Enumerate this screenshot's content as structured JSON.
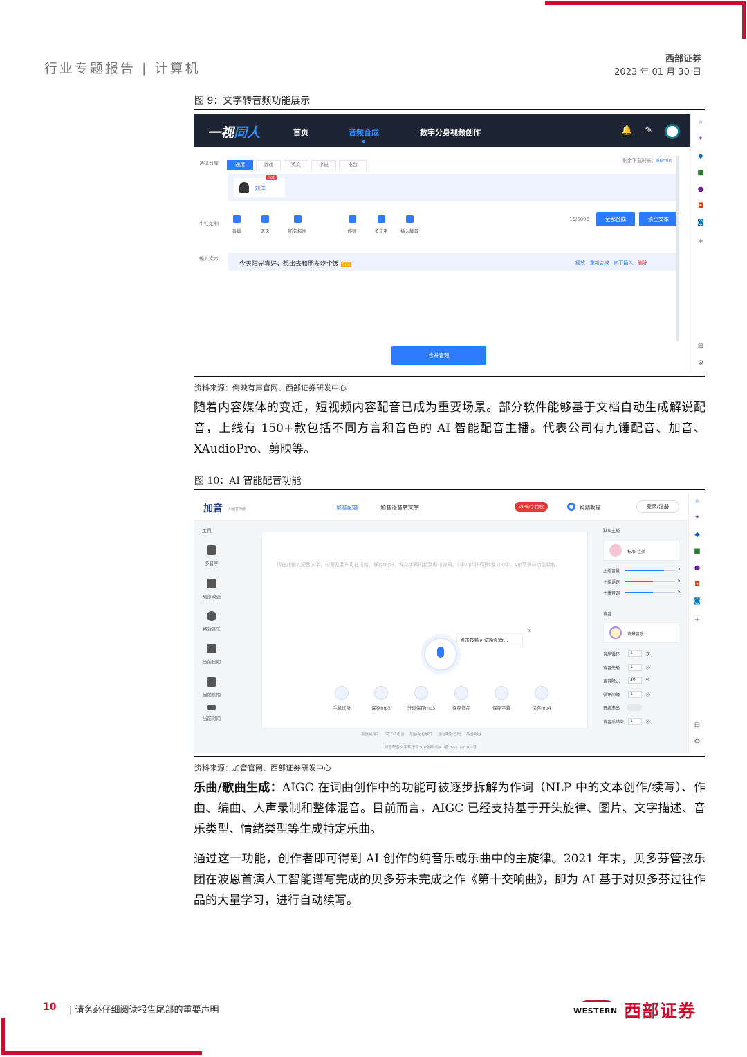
{
  "header": {
    "left": "行业专题报告 | 计算机",
    "brand": "西部证券",
    "date": "2023 年 01 月 30 日"
  },
  "fig9": {
    "caption": "图 9：文字转音频功能展示",
    "app": {
      "logo_prefix": "一视",
      "logo_suffix": "同人",
      "nav": [
        "首页",
        "音频合成",
        "数字分身视频创作"
      ],
      "active_nav": "音频合成",
      "label_library": "选择音库",
      "tabs": [
        "通用",
        "游戏",
        "英文",
        "小说",
        "电台"
      ],
      "download_limit": "剩余下载时长：",
      "download_value": "60min",
      "voice_name": "刘洋",
      "voice_badge": "hot",
      "label_custom": "个性定制",
      "tools": [
        "音量",
        "语速",
        "断句标准",
        "停顿",
        "多音字",
        "插入静音"
      ],
      "char_count": "16/5000",
      "btn_merge_all": "全部合成",
      "btn_clear": "清空文本",
      "label_input": "输入文本",
      "input_text": "今天阳光真好，想出去和朋友吃个饭",
      "input_badge": "500",
      "row_actions": [
        "播放",
        "重新合成",
        "向下插入",
        "删除"
      ],
      "btn_merge_audio": "合并音频"
    },
    "source": "资料来源：倒映有声官网、西部证券研发中心"
  },
  "para1": "随着内容媒体的变迁，短视频内容配音已成为重要场景。部分软件能够基于文档自动生成解说配音，上线有 150+款包括不同方言和音色的 AI 智能配音主播。代表公司有九锤配音、加音、XAudioPro、剪映等。",
  "fig10": {
    "caption": "图 10：AI 智能配音功能",
    "app": {
      "logo": "加音",
      "logo_sub": "AI配音神器",
      "nav": [
        "加音配音",
        "加音语音转文字"
      ],
      "vip": "VIP6/字特权",
      "tutorial": "视频教程",
      "login": "登录/注册",
      "tools_title": "工具",
      "tools": [
        "多音字",
        "局部改速",
        "特效音乐",
        "当前日期",
        "当前星期",
        "当前时间"
      ],
      "placeholder": "请在此输入配音文字，句号及回车可在试听、保存mp3、保存字幕时起到断句效果。（非vip用户可转换100字，vip享多样功能特权）",
      "mic_tip": "点击按钮可试听配音...",
      "functions": [
        "手机试听",
        "保存mp3",
        "分段保存mp3",
        "保存作品",
        "保存字幕",
        "保存mp4"
      ],
      "footer_links": [
        "友情链接：",
        "文字转语音",
        "加音配音软件",
        "加音配音官网",
        "加音配音"
      ],
      "icp": "加音配音文字转语音 ICP备案:粤ICP备2021018309号",
      "right": {
        "anchor_title": "默认主播",
        "anchor_name": "标准-佳美",
        "sliders": [
          {
            "label": "主播音量",
            "value": "7",
            "level": 0.78
          },
          {
            "label": "主播语速",
            "value": "5",
            "level": 0.55
          },
          {
            "label": "主播音调",
            "value": "5",
            "level": 0.55
          }
        ],
        "bg_title": "背音",
        "bg_name": "背景音乐",
        "fields": [
          {
            "label": "音乐循环",
            "value": "1",
            "unit": "次"
          },
          {
            "label": "背音先播",
            "value": "1",
            "unit": "秒"
          },
          {
            "label": "背音降比",
            "value": "30",
            "unit": "%"
          },
          {
            "label": "循环间隔",
            "value": "1",
            "unit": "秒"
          },
          {
            "label": "开启渐出",
            "value": "",
            "unit": ""
          },
          {
            "label": "背音后结束",
            "value": "1",
            "unit": "秒"
          }
        ]
      }
    },
    "source": "资料来源：加音官网、西部证券研发中心"
  },
  "para2_bold": "乐曲/歌曲生成：",
  "para2": "AIGC 在词曲创作中的功能可被逐步拆解为作词（NLP 中的文本创作/续写）、作曲、编曲、人声录制和整体混音。目前而言，AIGC 已经支持基于开头旋律、图片、文字描述、音乐类型、情绪类型等生成特定乐曲。",
  "para3": "通过这一功能，创作者即可得到 AI 创作的纯音乐或乐曲中的主旋律。2021 年末，贝多芬管弦乐团在波恩首演人工智能谱写完成的贝多芬未完成之作《第十交响曲》，即为 AI 基于对贝多芬过往作品的大量学习，进行自动续写。",
  "footer": {
    "page": "10",
    "note": "请务必仔细阅读报告尾部的重要声明",
    "logo_en": "WESTERN",
    "logo_cn": "西部证券"
  },
  "colors": {
    "accent": "#c8102e",
    "ui_blue": "#2f7bff",
    "navbar": "#1d2433"
  }
}
